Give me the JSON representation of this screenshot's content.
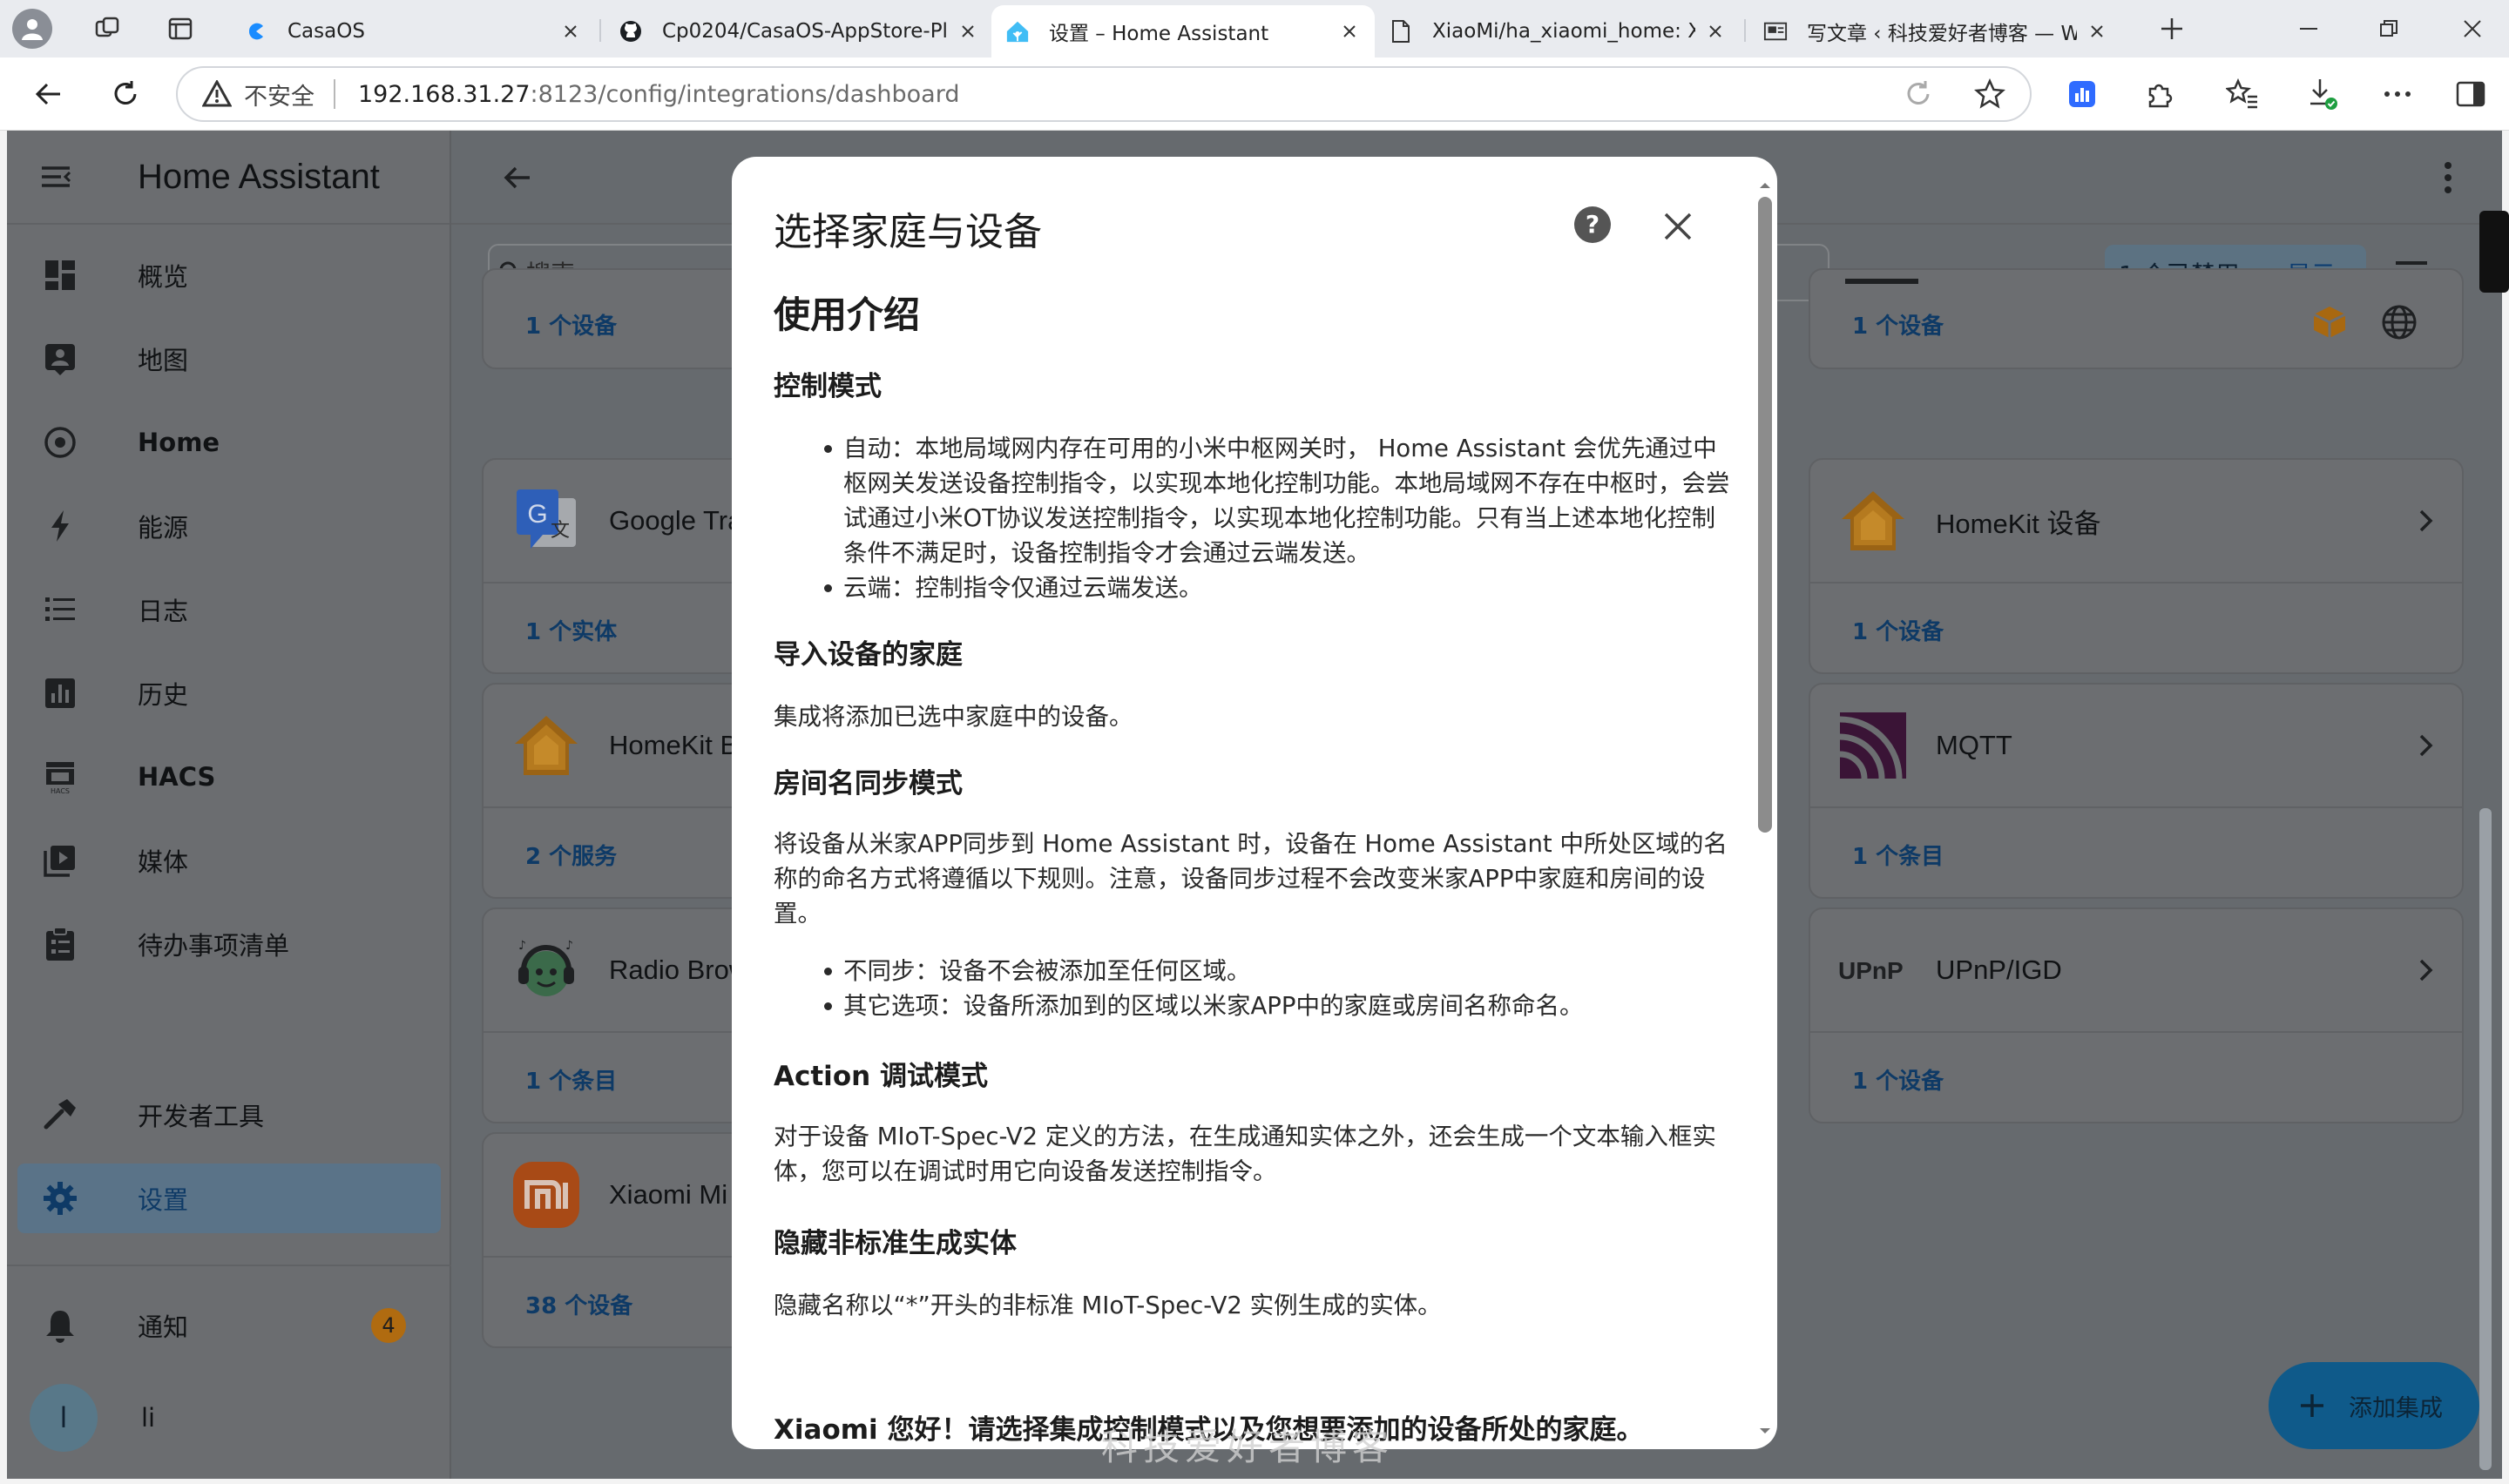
{
  "browser": {
    "tabs": [
      {
        "title": "CasaOS",
        "active": false
      },
      {
        "title": "Cp0204/CasaOS-AppStore-Pla",
        "active": false
      },
      {
        "title": "设置 – Home Assistant",
        "active": true
      },
      {
        "title": "XiaoMi/ha_xiaomi_home: Xiao",
        "active": false
      },
      {
        "title": "写文章 ‹ 科技爱好者博客 — W",
        "active": false
      }
    ],
    "address": {
      "security_label": "不安全",
      "host": "192.168.31.27",
      "path": ":8123/config/integrations/dashboard"
    }
  },
  "sidebar": {
    "title": "Home Assistant",
    "items": [
      {
        "label": "概览",
        "icon": "dashboard-icon"
      },
      {
        "label": "地图",
        "icon": "map-icon"
      },
      {
        "label": "Home",
        "icon": "home-target-icon"
      },
      {
        "label": "能源",
        "icon": "lightning-icon"
      },
      {
        "label": "日志",
        "icon": "list-icon"
      },
      {
        "label": "历史",
        "icon": "chart-icon"
      },
      {
        "label": "HACS",
        "icon": "hacs-icon"
      },
      {
        "label": "媒体",
        "icon": "media-icon"
      },
      {
        "label": "待办事项清单",
        "icon": "clipboard-icon"
      }
    ],
    "dev_tools": "开发者工具",
    "settings": "设置",
    "notifications": {
      "label": "通知",
      "count": "4"
    },
    "user": {
      "initial": "l",
      "name": "li"
    }
  },
  "main": {
    "search_placeholder": "搜索",
    "filter": {
      "disabled": "1 个已禁用",
      "show": "显示"
    },
    "cards_left": [
      {
        "name": "",
        "link": "1 个设备"
      },
      {
        "name": "Google Tra",
        "link": "1 个实体"
      },
      {
        "name": "HomeKit B",
        "link": "2 个服务"
      },
      {
        "name": "Radio Brow",
        "link": "1 个条目"
      },
      {
        "name": "Xiaomi Mi",
        "link": "38 个设备"
      }
    ],
    "cards_right": [
      {
        "name": "",
        "link": "1 个设备"
      },
      {
        "name": "HomeKit 设备",
        "link": "1 个设备"
      },
      {
        "name": "MQTT",
        "link": "1 个条目"
      },
      {
        "name": "UPnP/IGD",
        "link": "1 个设备"
      }
    ],
    "fab_label": "添加集成"
  },
  "dialog": {
    "title": "选择家庭与设备",
    "intro_heading": "使用介绍",
    "control_mode_heading": "控制模式",
    "control_mode_items": [
      "自动：本地局域网内存在可用的小米中枢网关时， Home Assistant 会优先通过中枢网关发送设备控制指令，以实现本地化控制功能。本地局域网不存在中枢时，会尝试通过小米OT协议发送控制指令，以实现本地化控制功能。只有当上述本地化控制条件不满足时，设备控制指令才会通过云端发送。",
      "云端：控制指令仅通过云端发送。"
    ],
    "import_home_heading": "导入设备的家庭",
    "import_home_text": "集成将添加已选中家庭中的设备。",
    "room_sync_heading": "房间名同步模式",
    "room_sync_text": "将设备从米家APP同步到 Home Assistant 时，设备在 Home Assistant 中所处区域的名称的命名方式将遵循以下规则。注意，设备同步过程不会改变米家APP中家庭和房间的设置。",
    "room_sync_items": [
      "不同步：设备不会被添加至任何区域。",
      "其它选项：设备所添加到的区域以米家APP中的家庭或房间名称命名。"
    ],
    "action_heading": "Action 调试模式",
    "action_text": "对于设备 MIoT-Spec-V2 定义的方法，在生成通知实体之外，还会生成一个文本输入框实体，您可以在调试时用它向设备发送控制指令。",
    "hide_heading": "隐藏非标准生成实体",
    "hide_text": "隐藏名称以“*”开头的非标准 MIoT-Spec-V2 实例生成的实体。",
    "greeting": "Xiaomi 您好！请选择集成控制模式以及您想要添加的设备所处的家庭。"
  },
  "watermark": "科技爱好者博客"
}
